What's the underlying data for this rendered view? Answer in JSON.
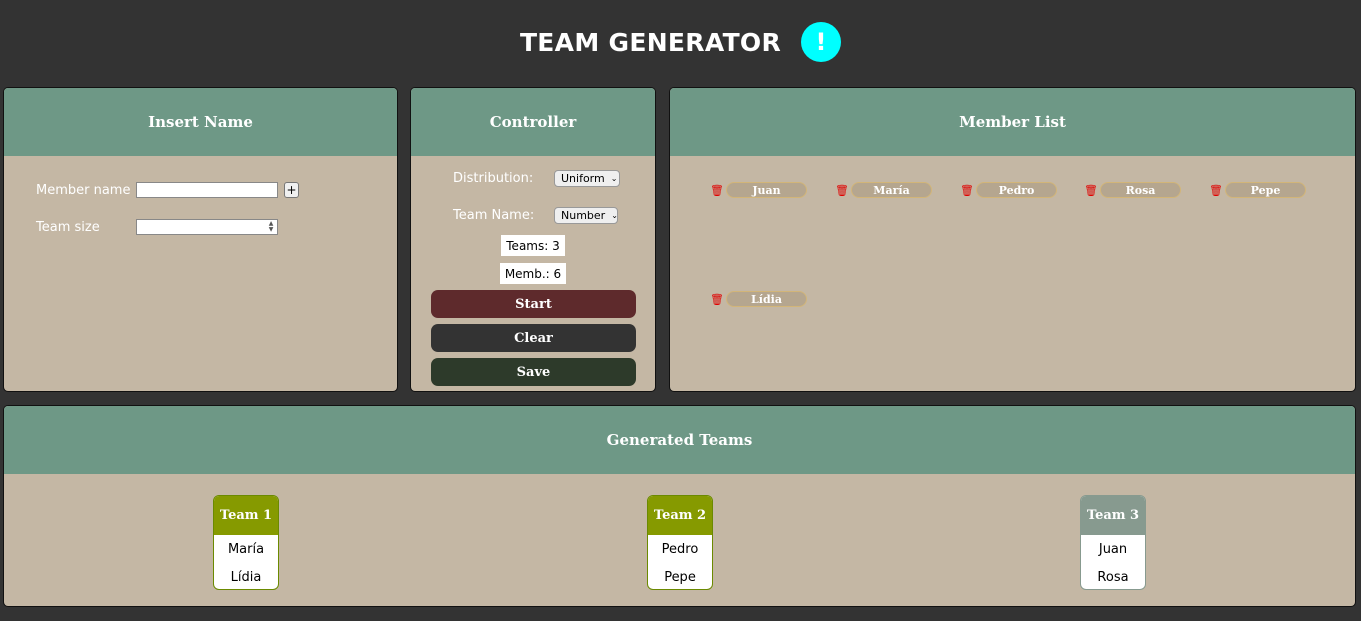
{
  "app": {
    "title": "TEAM GENERATOR",
    "info_glyph": "!"
  },
  "insert": {
    "heading": "Insert Name",
    "member_label": "Member name",
    "member_value": "",
    "add_label": "+",
    "size_label": "Team size",
    "size_value": ""
  },
  "controller": {
    "heading": "Controller",
    "distribution_label": "Distribution:",
    "distribution_value": "Uniform",
    "teamname_label": "Team Name:",
    "teamname_value": "Number",
    "teams_text": "Teams: 3",
    "members_text": "Memb.: 6",
    "start_label": "Start",
    "clear_label": "Clear",
    "save_label": "Save",
    "colors": {
      "start": "#5e2a2c",
      "clear": "#333333",
      "save": "#2d3a2a"
    }
  },
  "members": {
    "heading": "Member List",
    "items": [
      "Juan",
      "María",
      "Pedro",
      "Rosa",
      "Pepe",
      "Lídia"
    ]
  },
  "teams": {
    "heading": "Generated Teams",
    "list": [
      {
        "name": "Team 1",
        "color": "#869a00",
        "members": [
          "María",
          "Lídia"
        ]
      },
      {
        "name": "Team 2",
        "color": "#869a00",
        "members": [
          "Pedro",
          "Pepe"
        ]
      },
      {
        "name": "Team 3",
        "color": "#879a8f",
        "members": [
          "Juan",
          "Rosa"
        ]
      }
    ]
  },
  "colors": {
    "background": "#333333",
    "panel_header": "#6e9886",
    "panel_body": "#c4b7a4",
    "accent_info": "#00ffff",
    "trash": "#e00000"
  }
}
